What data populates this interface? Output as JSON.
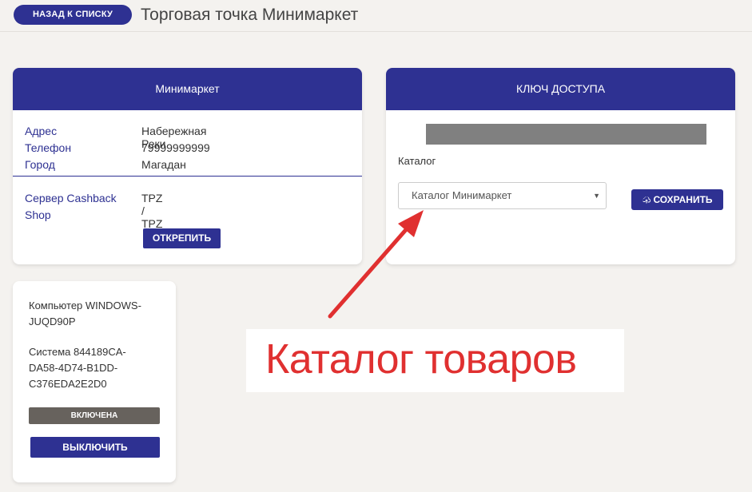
{
  "header": {
    "back_label": "НАЗАД К СПИСКУ",
    "title": "Торговая точка Минимаркет"
  },
  "store_card": {
    "title": "Минимаркет",
    "rows": [
      {
        "label": "Адрес",
        "value": "Набережная Реки"
      },
      {
        "label": "Телефон",
        "value": "79999999999"
      },
      {
        "label": "Город",
        "value": "Магадан"
      }
    ],
    "server_label_line1": "Сервер Cashback",
    "server_label_line2": "Shop",
    "server_value": "TPZ / TPZ",
    "detach_label": "ОТКРЕПИТЬ"
  },
  "key_card": {
    "title": "КЛЮЧ ДОСТУПА",
    "catalog_label": "Каталог",
    "catalog_selected": "Каталог Минимаркет",
    "save_label": "СОХРАНИТЬ"
  },
  "device_card": {
    "computer_line1": "Компьютер WINDOWS-",
    "computer_line2": "JUQD90P",
    "system_line1": "Система 844189CA-",
    "system_line2": "DA58-4D74-B1DD-",
    "system_line3": "C376EDA2E2D0",
    "status": "ВКЛЮЧЕНА",
    "disable_label": "ВЫКЛЮЧИТЬ"
  },
  "annotation": {
    "text": "Каталог товаров"
  },
  "colors": {
    "primary": "#2e3192",
    "annotation": "#e03030",
    "status_badge": "#67625d",
    "background": "#f4f2ef"
  }
}
